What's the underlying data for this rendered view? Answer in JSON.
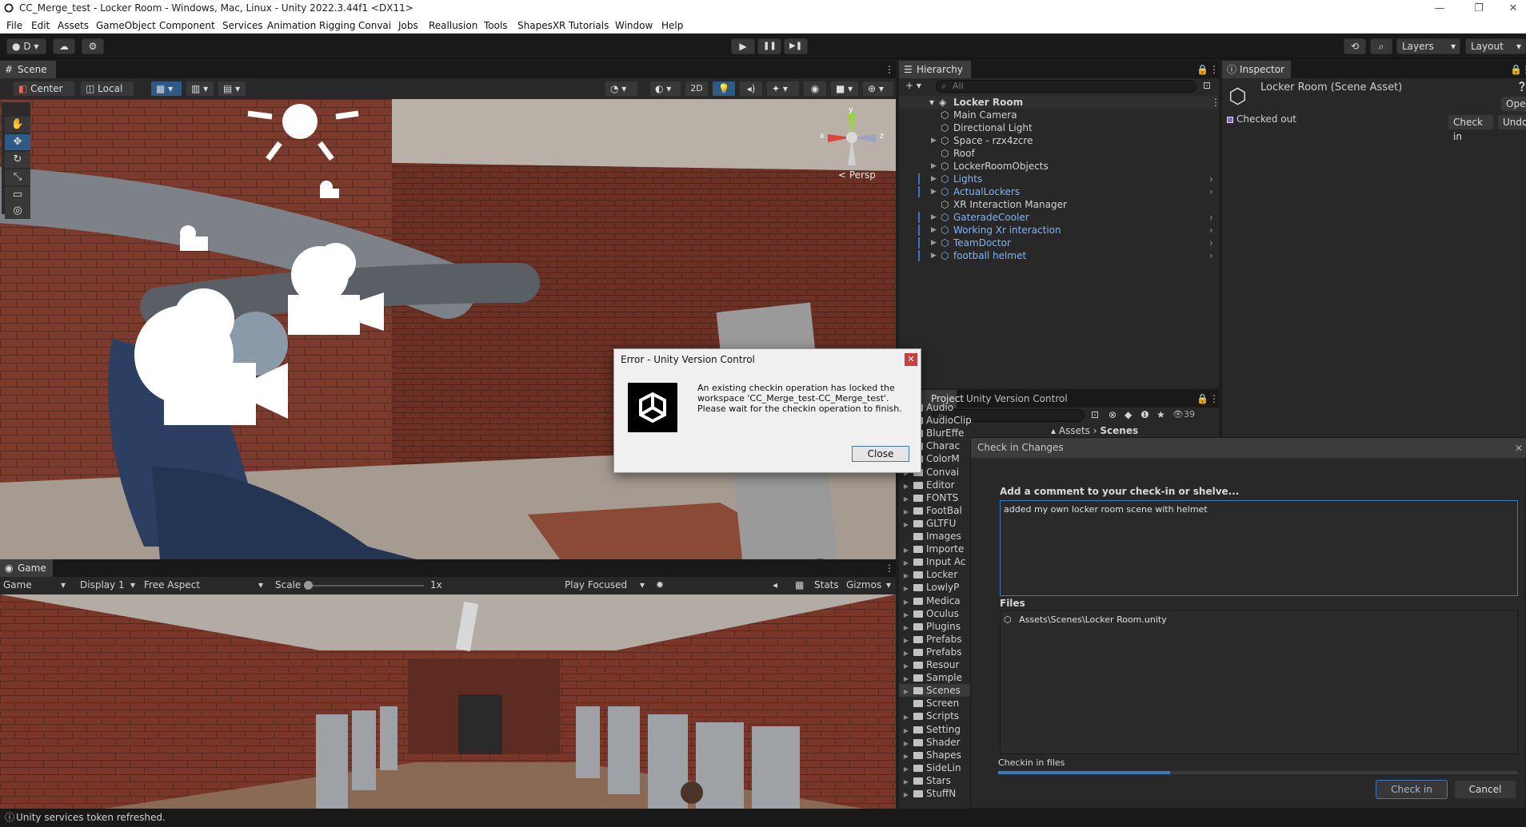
{
  "window": {
    "title": "CC_Merge_test - Locker Room - Windows, Mac, Linux - Unity 2022.3.44f1 <DX11>",
    "minimize": "—",
    "maximize": "❐",
    "close": "✕"
  },
  "menu": [
    "File",
    "Edit",
    "Assets",
    "GameObject",
    "Component",
    "Services",
    "Animation Rigging",
    "Convai",
    "Jobs",
    "Reallusion",
    "Tools",
    "ShapesXR",
    "Tutorials",
    "Window",
    "Help"
  ],
  "toolbar": {
    "account": "D",
    "play_icon": "▶",
    "pause_icon": "❚❚",
    "step_icon": "▶❚",
    "layers": "Layers",
    "layout": "Layout"
  },
  "scene": {
    "tab": "Scene",
    "pivot": "Center",
    "space": "Local",
    "mode_2d": "2D",
    "persp": "< Persp",
    "gizmo_y": "y",
    "gizmo_x": "x",
    "gizmo_z": "z"
  },
  "game": {
    "tab": "Game",
    "mode": "Game",
    "display": "Display 1",
    "aspect": "Free Aspect",
    "scale_label": "Scale",
    "scale_value": 0.0,
    "scale_text": "1x",
    "play_focused": "Play Focused",
    "stats": "Stats",
    "gizmos": "Gizmos"
  },
  "hierarchy": {
    "tab": "Hierarchy",
    "search_placeholder": "All",
    "root": "Locker Room",
    "items": [
      {
        "label": "Main Camera",
        "blue": false,
        "arrow": false
      },
      {
        "label": "Directional Light",
        "blue": false,
        "arrow": false
      },
      {
        "label": "Space - rzx4zcre",
        "blue": false,
        "arrow": true
      },
      {
        "label": "Roof",
        "blue": false,
        "arrow": false
      },
      {
        "label": "LockerRoomObjects",
        "blue": false,
        "arrow": true
      },
      {
        "label": "Lights",
        "blue": true,
        "arrow": true
      },
      {
        "label": "ActualLockers",
        "blue": true,
        "arrow": true
      },
      {
        "label": "XR Interaction Manager",
        "blue": false,
        "arrow": false
      },
      {
        "label": "GateradeCooler",
        "blue": true,
        "arrow": true
      },
      {
        "label": "Working Xr interaction",
        "blue": true,
        "arrow": true
      },
      {
        "label": "TeamDoctor",
        "blue": true,
        "arrow": true
      },
      {
        "label": "football helmet",
        "blue": true,
        "arrow": true
      }
    ]
  },
  "inspector": {
    "tab": "Inspector",
    "title": "Locker Room (Scene Asset)",
    "open": "Open",
    "status": "Checked out",
    "checkin": "Check in",
    "undo": "Undo"
  },
  "project": {
    "tab_project": "Project",
    "tab_uvc": "Unity Version Control",
    "count": "39",
    "breadcrumb": [
      "Assets",
      "Scenes"
    ],
    "folders": [
      "Audio",
      "AudioClips",
      "BlurEffe",
      "Charac",
      "ColorM",
      "Convai",
      "Editor",
      "FONTS",
      "FootBal",
      "GLTFU",
      "Images",
      "Importe",
      "Input Ac",
      "Locker",
      "LowlyP",
      "Medica",
      "Oculus",
      "Plugins",
      "Prefabs",
      "Prefabs",
      "Resour",
      "Sample",
      "Scenes",
      "Screen",
      "Scripts",
      "Setting",
      "Shader",
      "Shapes",
      "SideLin",
      "Stars",
      "StuffN"
    ]
  },
  "checkin_dialog": {
    "title": "Check in Changes",
    "comment_label": "Add a comment to your check-in or shelve...",
    "comment": "added my own locker room scene with helmet",
    "files_label": "Files",
    "file": "Assets\\Scenes\\Locker Room.unity",
    "progress_label": "Checkin in files",
    "progress": 0.33,
    "checkin_button": "Check in",
    "cancel_button": "Cancel"
  },
  "error_dialog": {
    "title": "Error - Unity Version Control",
    "message": "An existing checkin operation has locked the workspace 'CC_Merge_test-CC_Merge_test'. Please wait for the checkin operation to finish.",
    "close_button": "Close"
  },
  "status": {
    "message": "Unity services token refreshed."
  },
  "colors": {
    "accent": "#3a79bb",
    "prefab_blue": "#7cb3ff",
    "progress": "#3a79bb"
  }
}
